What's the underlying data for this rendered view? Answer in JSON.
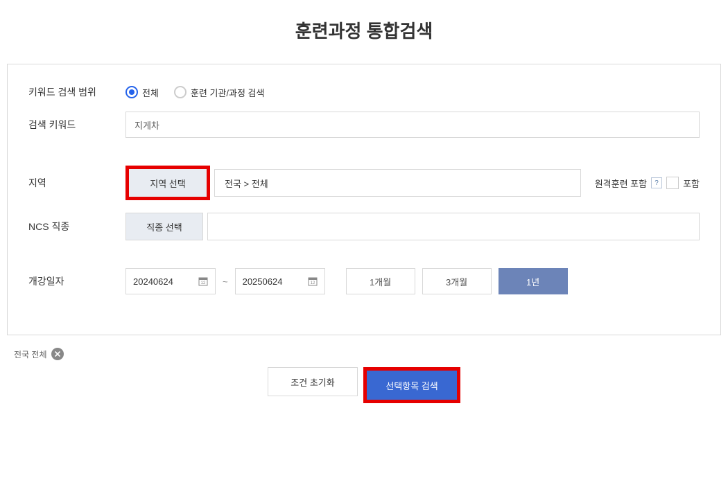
{
  "page": {
    "title": "훈련과정 통합검색"
  },
  "form": {
    "keyword_scope": {
      "label": "키워드 검색 범위",
      "options": [
        {
          "label": "전체",
          "selected": true
        },
        {
          "label": "훈련 기관/과정 검색",
          "selected": false
        }
      ]
    },
    "keyword": {
      "label": "검색 키워드",
      "value": "지게차"
    },
    "region": {
      "label": "지역",
      "select_btn": "지역 선택",
      "value": "전국 > 전체",
      "remote_label": "원격훈련 포함",
      "help": "?",
      "include_label": "포함"
    },
    "ncs": {
      "label": "NCS 직종",
      "select_btn": "직종 선택"
    },
    "start_date": {
      "label": "개강일자",
      "from": "20240624",
      "to": "20250624",
      "periods": [
        {
          "label": "1개월",
          "active": false
        },
        {
          "label": "3개월",
          "active": false
        },
        {
          "label": "1년",
          "active": true
        }
      ]
    }
  },
  "filters": {
    "tag": "전국 전체"
  },
  "actions": {
    "reset": "조건 초기화",
    "submit": "선택항목 검색"
  }
}
